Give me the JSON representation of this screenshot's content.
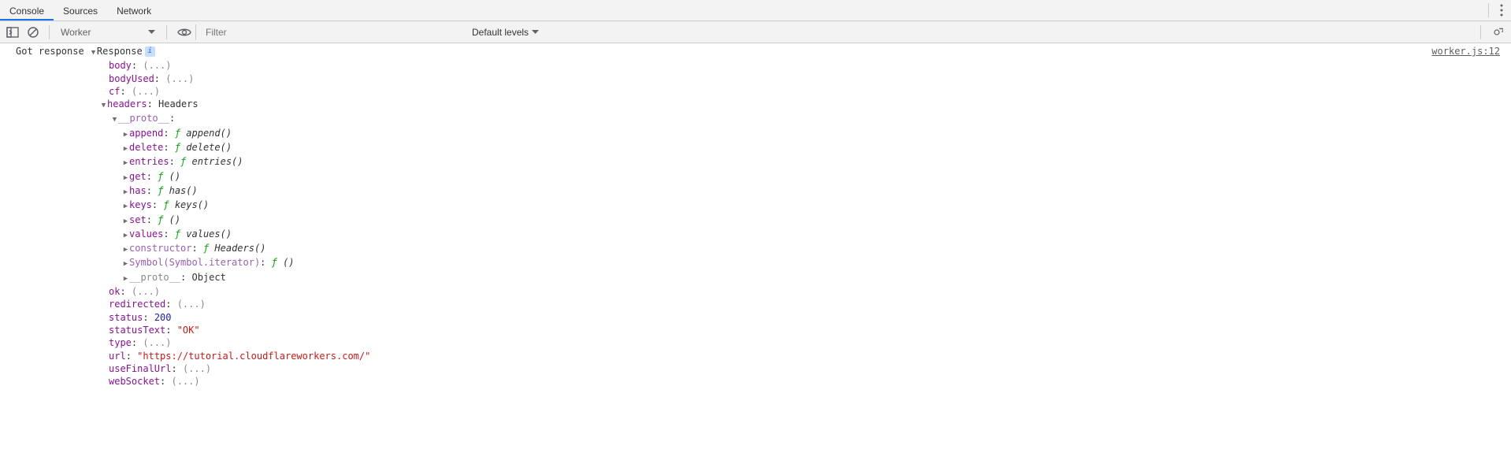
{
  "tabs": {
    "console": "Console",
    "sources": "Sources",
    "network": "Network"
  },
  "toolbar": {
    "context": "Worker",
    "filter_placeholder": "Filter",
    "levels": "Default levels"
  },
  "log": {
    "prefix": "Got response ",
    "object_name": "Response",
    "source": "worker.js:12",
    "props": {
      "body": {
        "key": "body",
        "ell": "(...)"
      },
      "bodyUsed": {
        "key": "bodyUsed",
        "ell": "(...)"
      },
      "cf": {
        "key": "cf",
        "ell": "(...)"
      },
      "headers": {
        "key": "headers",
        "val": "Headers"
      },
      "proto": {
        "key": "__proto__"
      },
      "append": {
        "key": "append",
        "fn": "append()"
      },
      "delete": {
        "key": "delete",
        "fn": "delete()"
      },
      "entries": {
        "key": "entries",
        "fn": "entries()"
      },
      "get": {
        "key": "get",
        "fn": "()"
      },
      "has": {
        "key": "has",
        "fn": "has()"
      },
      "keys": {
        "key": "keys",
        "fn": "keys()"
      },
      "set": {
        "key": "set",
        "fn": "()"
      },
      "values": {
        "key": "values",
        "fn": "values()"
      },
      "constructor": {
        "key": "constructor",
        "fn": "Headers()"
      },
      "symbol": {
        "key": "Symbol(Symbol.iterator)",
        "fn": "()"
      },
      "proto2": {
        "key": "__proto__",
        "val": "Object"
      },
      "ok": {
        "key": "ok",
        "ell": "(...)"
      },
      "redirected": {
        "key": "redirected",
        "ell": "(...)"
      },
      "status": {
        "key": "status",
        "num": "200"
      },
      "statusText": {
        "key": "statusText",
        "str": "\"OK\""
      },
      "type": {
        "key": "type",
        "ell": "(...)"
      },
      "url": {
        "key": "url",
        "str": "\"https://tutorial.cloudflareworkers.com/\""
      },
      "useFinalUrl": {
        "key": "useFinalUrl",
        "ell": "(...)"
      },
      "webSocket": {
        "key": "webSocket",
        "ell": "(...)"
      }
    }
  }
}
